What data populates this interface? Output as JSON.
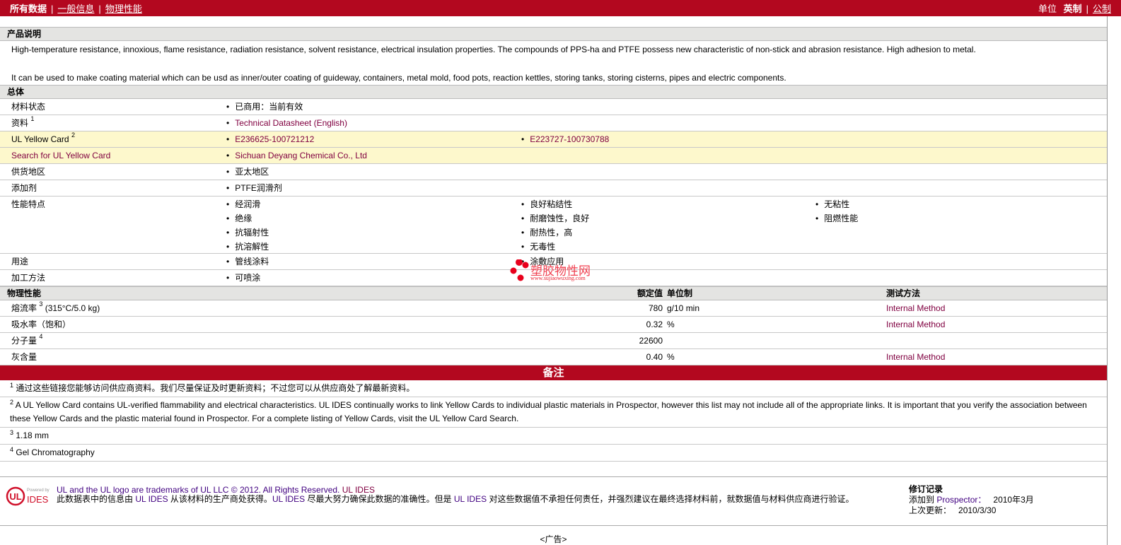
{
  "topbar": {
    "all_data": "所有数据",
    "general_info": "一般信息",
    "physical": "物理性能",
    "units_label": "单位",
    "unit_imperial": "英制",
    "unit_metric": "公制"
  },
  "product": {
    "title": "产品说明",
    "desc1": "High-temperature resistance, innoxious, flame resistance, radiation resistance, solvent resistance, electrical insulation properties. The compounds of PPS-ha and PTFE possess new characteristic of non-stick and abrasion resistance. High adhesion to metal.",
    "desc2": "It can be used to make coating material which can be usd as inner/outer coating of guideway, containers, metal mold, food pots, reaction kettles, storing tanks, storing cisterns, pipes and electric components."
  },
  "general": {
    "title": "总体",
    "status_label": "材料状态",
    "status_value": "已商用：当前有效",
    "docs_label": "资料",
    "docs_sup": "1",
    "docs_value": "Technical Datasheet (English)",
    "ul_label": "UL Yellow Card",
    "ul_sup": "2",
    "ul_values": [
      "E236625-100721212",
      "E223727-100730788"
    ],
    "search_label": "Search for UL Yellow Card",
    "search_value": "Sichuan Deyang Chemical Co., Ltd",
    "region_label": "供货地区",
    "region_value": "亚太地区",
    "additive_label": "添加剂",
    "additive_value": "PTFE润滑剂",
    "features_label": "性能特点",
    "features": [
      [
        "经润滑",
        "绝缘",
        "抗辐射性",
        "抗溶解性"
      ],
      [
        "良好粘结性",
        "耐磨蚀性，良好",
        "耐热性，高",
        "无毒性"
      ],
      [
        "无粘性",
        "阻燃性能"
      ]
    ],
    "use_label": "用途",
    "uses": [
      "管线涂料",
      "涂敷应用"
    ],
    "process_label": "加工方法",
    "process_value": "可喷涂"
  },
  "physical": {
    "title": "物理性能",
    "col_value": "额定值",
    "col_unit": "单位制",
    "col_method": "测试方法",
    "rows": [
      {
        "name": "熔流率",
        "sup": "3",
        "cond": "(315°C/5.0 kg)",
        "value": "780",
        "unit": "g/10 min",
        "method": "Internal Method"
      },
      {
        "name": "吸水率（饱和）",
        "sup": "",
        "cond": "",
        "value": "0.32",
        "unit": "%",
        "method": "Internal Method"
      },
      {
        "name": "分子量",
        "sup": "4",
        "cond": "",
        "value": "22600",
        "unit": "",
        "method": ""
      },
      {
        "name": "灰含量",
        "sup": "",
        "cond": "",
        "value": "0.40",
        "unit": "%",
        "method": "Internal Method"
      }
    ]
  },
  "notes": {
    "title": "备注",
    "items": [
      {
        "n": "1",
        "text": "通过这些链接您能够访问供应商资料。我们尽量保证及时更新资料；不过您可以从供应商处了解最新资料。"
      },
      {
        "n": "2",
        "text": "A UL Yellow Card contains UL-verified flammability and electrical characteristics. UL IDES continually works to link Yellow Cards to individual plastic materials in Prospector, however this list may not include all of the appropriate links. It is important that you verify the association between these Yellow Cards and the plastic material found in Prospector. For a complete listing of Yellow Cards, visit the UL Yellow Card Search."
      },
      {
        "n": "3",
        "text": "1.18 mm"
      },
      {
        "n": "4",
        "text": "Gel Chromatography"
      }
    ]
  },
  "footer": {
    "logo_text": "Powered by UL IDES",
    "trademark": "UL and the UL logo are trademarks of UL LLC © 2012. All Rights Reserved.",
    "ul_ides": "UL IDES",
    "disc_a": "此数据表中的信息由 ",
    "disc_b": " 从该材料的生产商处获得。",
    "disc_c": " 尽最大努力确保此数据的准确性。但是 ",
    "disc_d": " 对这些数据值不承担任何责任，并强烈建议在最终选择材料前，就数据值与材料供应商进行验证。",
    "rev_title": "修订记录",
    "added_label": "添加到 ",
    "prospector": "Prospector：",
    "added_date": "2010年3月",
    "updated_label": "上次更新：",
    "updated_date": "2010/3/30"
  },
  "ad": "<广告>",
  "watermark": {
    "name": "塑胶物性网",
    "url": "www.sujiaowuxing.com"
  },
  "colors": {
    "brand": "#b3081f",
    "link": "#800040",
    "highlight": "#fdf8cc"
  }
}
